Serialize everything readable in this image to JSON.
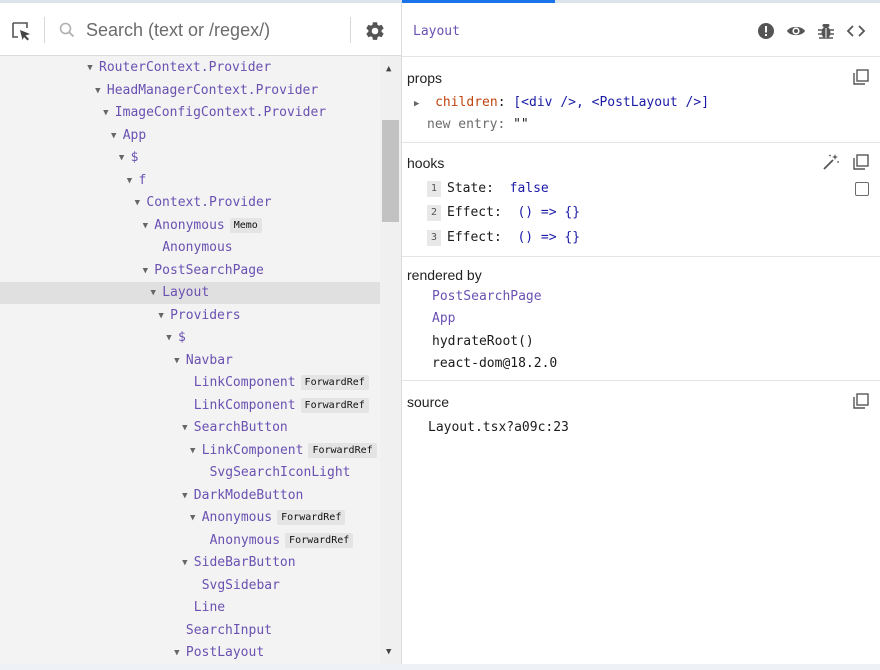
{
  "search": {
    "placeholder": "Search (text or /regex/)"
  },
  "tree": [
    {
      "label": "RouterContext.Provider",
      "depth": 0,
      "arrow": "▼"
    },
    {
      "label": "HeadManagerContext.Provider",
      "depth": 1,
      "arrow": "▼"
    },
    {
      "label": "ImageConfigContext.Provider",
      "depth": 2,
      "arrow": "▼"
    },
    {
      "label": "App",
      "depth": 3,
      "arrow": "▼"
    },
    {
      "label": "$",
      "depth": 4,
      "arrow": "▼"
    },
    {
      "label": "f",
      "depth": 5,
      "arrow": "▼"
    },
    {
      "label": "Context.Provider",
      "depth": 6,
      "arrow": "▼"
    },
    {
      "label": "Anonymous",
      "depth": 7,
      "arrow": "▼",
      "badge": "Memo"
    },
    {
      "label": "Anonymous",
      "depth": 8,
      "arrow": ""
    },
    {
      "label": "PostSearchPage",
      "depth": 7,
      "arrow": "▼"
    },
    {
      "label": "Layout",
      "depth": 8,
      "arrow": "▼",
      "selected": true
    },
    {
      "label": "Providers",
      "depth": 9,
      "arrow": "▼"
    },
    {
      "label": "$",
      "depth": 10,
      "arrow": "▼"
    },
    {
      "label": "Navbar",
      "depth": 11,
      "arrow": "▼"
    },
    {
      "label": "LinkComponent",
      "depth": 12,
      "arrow": "",
      "badge": "ForwardRef"
    },
    {
      "label": "LinkComponent",
      "depth": 12,
      "arrow": "",
      "badge": "ForwardRef"
    },
    {
      "label": "SearchButton",
      "depth": 12,
      "arrow": "▼"
    },
    {
      "label": "LinkComponent",
      "depth": 13,
      "arrow": "▼",
      "badge": "ForwardRef"
    },
    {
      "label": "SvgSearchIconLight",
      "depth": 14,
      "arrow": ""
    },
    {
      "label": "DarkModeButton",
      "depth": 12,
      "arrow": "▼"
    },
    {
      "label": "Anonymous",
      "depth": 13,
      "arrow": "▼",
      "badge": "ForwardRef"
    },
    {
      "label": "Anonymous",
      "depth": 14,
      "arrow": "",
      "badge": "ForwardRef"
    },
    {
      "label": "SideBarButton",
      "depth": 12,
      "arrow": "▼"
    },
    {
      "label": "SvgSidebar",
      "depth": 13,
      "arrow": ""
    },
    {
      "label": "Line",
      "depth": 12,
      "arrow": ""
    },
    {
      "label": "SearchInput",
      "depth": 11,
      "arrow": ""
    },
    {
      "label": "PostLayout",
      "depth": 11,
      "arrow": "▼"
    }
  ],
  "inspector": {
    "title": "Layout",
    "props": {
      "title": "props",
      "children_key": "children",
      "children_colon": ":",
      "children_value": "[<div />, <PostLayout />]",
      "new_entry_label": "new entry",
      "new_entry_colon": ":",
      "new_entry_value": "\"\""
    },
    "hooks": {
      "title": "hooks",
      "items": [
        {
          "num": "1",
          "name": "State:",
          "value": "false"
        },
        {
          "num": "2",
          "name": "Effect:",
          "value": "() => {}"
        },
        {
          "num": "3",
          "name": "Effect:",
          "value": "() => {}"
        }
      ]
    },
    "rendered_by": {
      "title": "rendered by",
      "links": [
        "PostSearchPage",
        "App"
      ],
      "plain": [
        "hydrateRoot()",
        "react-dom@18.2.0"
      ]
    },
    "source": {
      "title": "source",
      "value": "Layout.tsx?a09c:23"
    }
  },
  "colors": {
    "accent": "#1a73e8",
    "component": "#6a51b2",
    "prop_key": "#c1440e",
    "value": "#1a1aa6",
    "selected_row": "#e0e0e0"
  },
  "icons": [
    "select-element-icon",
    "search-icon",
    "gear-icon",
    "warning-icon",
    "eye-icon",
    "bug-icon",
    "code-icon",
    "copy-icon",
    "magic-wand-icon"
  ]
}
